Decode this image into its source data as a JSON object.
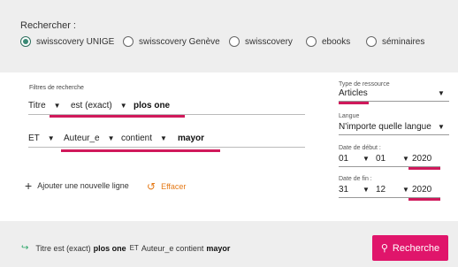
{
  "search": {
    "label": "Rechercher :",
    "scopes": [
      {
        "label": "swisscovery UNIGE",
        "selected": true
      },
      {
        "label": "swisscovery Genève",
        "selected": false
      },
      {
        "label": "swisscovery",
        "selected": false
      },
      {
        "label": "ebooks",
        "selected": false
      },
      {
        "label": "séminaires",
        "selected": false
      }
    ]
  },
  "filters": {
    "title": "Filtres de recherche",
    "rows": [
      {
        "field": "Titre",
        "operator": "est (exact)",
        "value": "plos one"
      },
      {
        "boolean": "ET",
        "field": "Auteur_e",
        "operator": "contient",
        "value": "mayor"
      }
    ],
    "add_line": "Ajouter une nouvelle ligne",
    "reset": "Effacer"
  },
  "facets": {
    "resource_type": {
      "label": "Type de ressource",
      "value": "Articles"
    },
    "language": {
      "label": "Langue",
      "value": "N'importe quelle langue"
    },
    "start_date": {
      "label": "Date de début :",
      "day": "01",
      "month": "01",
      "year": "2020"
    },
    "end_date": {
      "label": "Date de fin :",
      "day": "31",
      "month": "12",
      "year": "2020"
    }
  },
  "summary": {
    "part1": "Titre est (exact)",
    "value1": "plos one",
    "part2": "ET",
    "part3": "Auteur_e contient",
    "value2": "mayor"
  },
  "search_button": "Recherche",
  "colors": {
    "accent": "#e0156b",
    "underline": "#d0195b",
    "reset": "#e57a17",
    "radio_selected": "#3a8a75"
  }
}
